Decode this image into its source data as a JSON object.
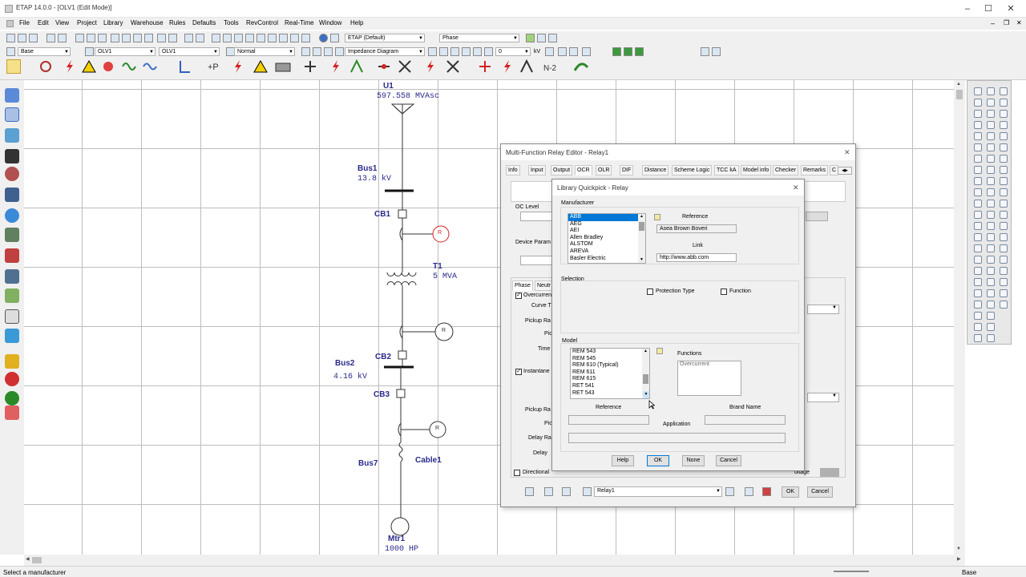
{
  "window": {
    "title": "ETAP 14.0.0 - [OLV1 (Edit Mode)]"
  },
  "menu": [
    "File",
    "Edit",
    "View",
    "Project",
    "Library",
    "Warehouse",
    "Rules",
    "Defaults",
    "Tools",
    "RevControl",
    "Real-Time",
    "Window",
    "Help"
  ],
  "toolbar1": {
    "config_combo": "ETAP (Default)",
    "phase_combo": "Phase"
  },
  "toolbar2": {
    "base_combo": "Base",
    "olv_combo1": "OLV1",
    "olv_combo2": "OLV1",
    "normal_combo": "Normal",
    "diagram_combo": "Impedance Diagram",
    "number_combo": "0",
    "unit_kv": "kV"
  },
  "toolbar3": {
    "contingency_label": "N-2"
  },
  "sld": {
    "u1_name": "U1",
    "u1_value": "597.558 MVAsc",
    "bus1_name": "Bus1",
    "bus1_value": "13.8 kV",
    "cb1": "CB1",
    "relay_label": "R",
    "t1_name": "T1",
    "t1_value": "5 MVA",
    "cb2": "CB2",
    "bus2_name": "Bus2",
    "bus2_value": "4.16 kV",
    "cb3": "CB3",
    "bus7": "Bus7",
    "cable1": "Cable1",
    "mtr1_name": "Mtr1",
    "mtr1_value": "1000 HP"
  },
  "relay_editor": {
    "title": "Multi-Function Relay Editor - Relay1",
    "tabs": [
      "Info",
      "Input",
      "Output",
      "OCR",
      "OLR",
      "DIF",
      "Distance",
      "Scheme Logic",
      "TCC kA",
      "Model info",
      "Checker",
      "Remarks",
      "C"
    ],
    "selected_tab": "OCR",
    "oc_level": "OC Level",
    "device_param": "Device Param",
    "phase_tab": "Phase",
    "neutral_tab": "Neutr",
    "overcurrent": "Overcurren",
    "curve": "Curve T",
    "pickup_range": "Pickup Ra",
    "pickup": "Pic",
    "time": "Time",
    "instantaneous": "Instantane",
    "pickup_range2": "Pickup Ra",
    "pickup2": "Pic",
    "delay_range": "Delay Ra",
    "delay": "Delay",
    "directional": "Directional",
    "voltage": "oltage",
    "relay_id": "Relay1",
    "ok": "OK",
    "cancel": "Cancel"
  },
  "quickpick": {
    "title": "Library Quickpick - Relay",
    "manufacturer_label": "Manufacturer",
    "manufacturers": [
      "ABB",
      "AEG",
      "AEI",
      "Allen Bradley",
      "ALSTOM",
      "AREVA",
      "Basler Electric"
    ],
    "selected_manufacturer": "ABB",
    "reference_label": "Reference",
    "reference_value": "Asea Brown Boveri",
    "link_label": "Link",
    "link_value": "http://www.abb.com",
    "selection_label": "Selection",
    "protection_type": "Protection Type",
    "function_label": "Function",
    "model_label": "Model",
    "models": [
      "REM 543",
      "REM 545",
      "REM 610 (Typical)",
      "REM 611",
      "REM 615",
      "RET 541",
      "RET 543"
    ],
    "functions_label": "Functions",
    "functions": [
      "Overcurrent"
    ],
    "model_reference_label": "Reference",
    "brand_name_label": "Brand Name",
    "application_label": "Application",
    "help": "Help",
    "ok": "OK",
    "none": "None",
    "cancel": "Cancel"
  },
  "status": {
    "left": "Select a manufacturer",
    "right": "Base"
  },
  "colors": {
    "sld_blue": "#2a2a8c",
    "relay_red": "#d42020",
    "selection_blue": "#0078d7"
  }
}
